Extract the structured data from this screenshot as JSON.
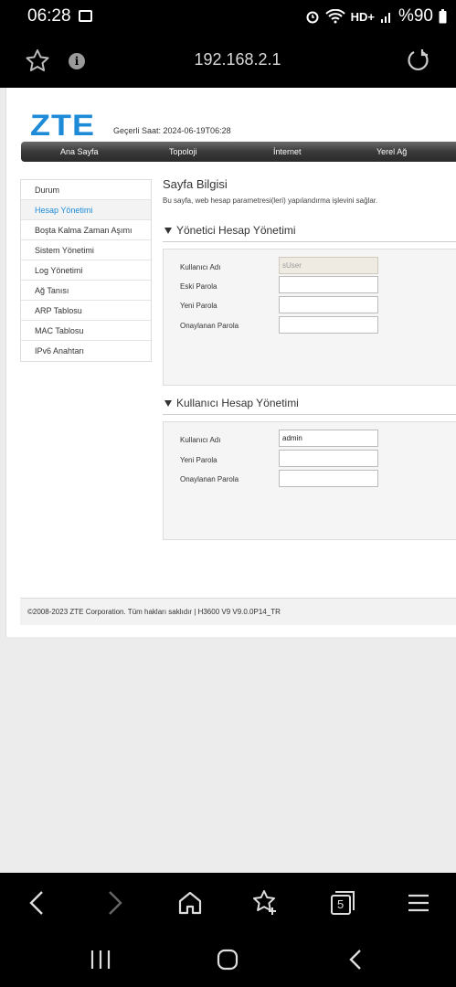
{
  "status_bar": {
    "time": "06:28",
    "battery": "%90",
    "network": "HD+"
  },
  "browser": {
    "url": "192.168.2.1",
    "tab_count": "5"
  },
  "page": {
    "logo": "ZTE",
    "current_time": "Geçerli Saat: 2024-06-19T06:28",
    "nav": [
      "Ana Sayfa",
      "Topoloji",
      "İnternet",
      "Yerel Ağ"
    ],
    "sidebar": [
      {
        "label": "Durum",
        "active": false
      },
      {
        "label": "Hesap Yönetimi",
        "active": true
      },
      {
        "label": "Boşta Kalma Zaman Aşımı",
        "active": false
      },
      {
        "label": "Sistem Yönetimi",
        "active": false
      },
      {
        "label": "Log Yönetimi",
        "active": false
      },
      {
        "label": "Ağ Tanısı",
        "active": false
      },
      {
        "label": "ARP Tablosu",
        "active": false
      },
      {
        "label": "MAC Tablosu",
        "active": false
      },
      {
        "label": "IPv6 Anahtarı",
        "active": false
      }
    ],
    "info_title": "Sayfa Bilgisi",
    "info_desc": "Bu sayfa, web hesap parametresi(leri) yapılandırma işlevini sağlar.",
    "admin_section": {
      "title": "Yönetici Hesap Yönetimi",
      "username_label": "Kullanıcı Adı",
      "username_value": "sUser",
      "old_password_label": "Eski Parola",
      "new_password_label": "Yeni Parola",
      "confirm_password_label": "Onaylanan Parola"
    },
    "user_section": {
      "title": "Kullanıcı Hesap Yönetimi",
      "username_label": "Kullanıcı Adı",
      "username_value": "admin",
      "new_password_label": "Yeni Parola",
      "confirm_password_label": "Onaylanan Parola"
    },
    "footer": "©2008-2023 ZTE Corporation. Tüm hakları saklıdır  |   H3600 V9 V9.0.0P14_TR"
  },
  "colors": {
    "accent": "#1d8bd8",
    "nav_dark": "#2a2a2a"
  }
}
